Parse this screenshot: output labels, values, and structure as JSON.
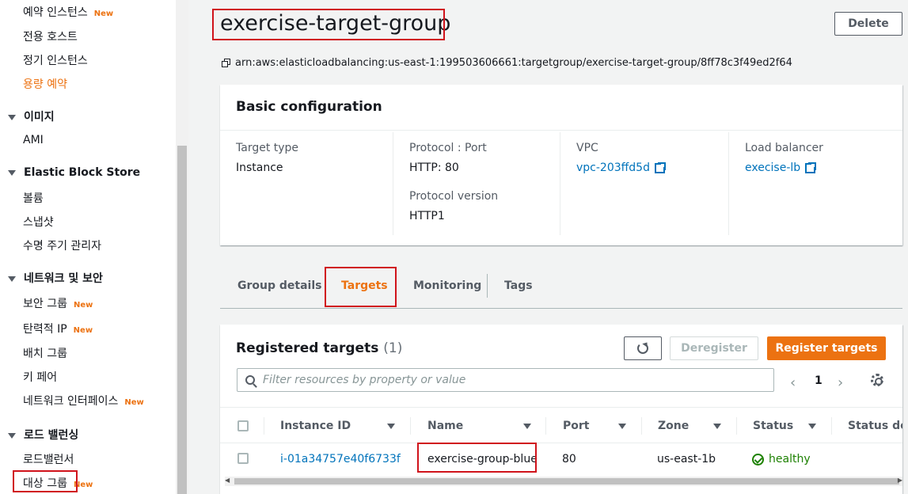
{
  "sidebar": {
    "items": [
      {
        "label": "예약 인스턴스",
        "new": "New"
      },
      {
        "label": "전용 호스트"
      },
      {
        "label": "정기 인스턴스"
      },
      {
        "label": "용량 예약"
      }
    ],
    "sections": {
      "images": {
        "title": "이미지",
        "items": [
          "AMI"
        ]
      },
      "ebs": {
        "title": "Elastic Block Store",
        "items": [
          "볼륨",
          "스냅샷",
          "수명 주기 관리자"
        ]
      },
      "network": {
        "title": "네트워크 및 보안",
        "items": [
          {
            "label": "보안 그룹",
            "new": "New"
          },
          {
            "label": "탄력적 IP",
            "new": "New"
          },
          {
            "label": "배치 그룹"
          },
          {
            "label": "키 페어"
          },
          {
            "label": "네트워크 인터페이스",
            "new": "New"
          }
        ]
      },
      "lb": {
        "title": "로드 밸런싱",
        "items": [
          {
            "label": "로드밸런서"
          },
          {
            "label": "대상 그룹",
            "new": "New"
          }
        ]
      }
    }
  },
  "header": {
    "title": "exercise-target-group",
    "delete_label": "Delete",
    "arn": "arn:aws:elasticloadbalancing:us-east-1:199503606661:targetgroup/exercise-target-group/8ff78c3f49ed2f64"
  },
  "basic_config": {
    "title": "Basic configuration",
    "target_type_label": "Target type",
    "target_type": "Instance",
    "protocol_port_label": "Protocol : Port",
    "protocol_port": "HTTP: 80",
    "protocol_version_label": "Protocol version",
    "protocol_version": "HTTP1",
    "vpc_label": "VPC",
    "vpc": "vpc-203ffd5d",
    "lb_label": "Load balancer",
    "lb": "execise-lb"
  },
  "tabs": [
    "Group details",
    "Targets",
    "Monitoring",
    "Tags"
  ],
  "targets": {
    "title": "Registered targets",
    "count": "(1)",
    "deregister_label": "Deregister",
    "register_label": "Register targets",
    "filter_placeholder": "Filter resources by property or value",
    "page": "1",
    "columns": [
      "Instance ID",
      "Name",
      "Port",
      "Zone",
      "Status",
      "Status de..."
    ],
    "rows": [
      {
        "instance_id": "i-01a34757e40f6733f",
        "name": "exercise-group-blue",
        "port": "80",
        "zone": "us-east-1b",
        "status": "healthy"
      }
    ]
  },
  "colors": {
    "accent": "#ec7211",
    "link": "#0073bb",
    "healthy": "#1d8102",
    "highlight": "#d0131b"
  }
}
